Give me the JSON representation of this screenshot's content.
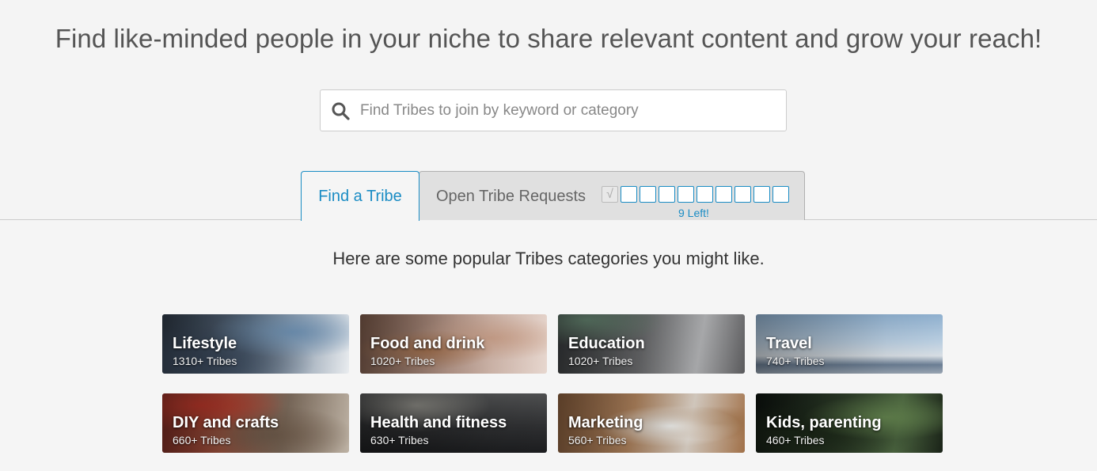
{
  "headline": "Find like-minded people in your niche to share relevant content and grow your reach!",
  "search": {
    "placeholder": "Find Tribes to join by keyword or category",
    "value": "",
    "icon": "search-icon"
  },
  "tabs": {
    "find_label": "Find a Tribe",
    "open_label": "Open Tribe Requests",
    "requests_used": 1,
    "requests_total": 10,
    "left_label": "9 Left!"
  },
  "subtitle": "Here are some popular Tribes categories you might like.",
  "categories": [
    {
      "title": "Lifestyle",
      "count": "1310+ Tribes"
    },
    {
      "title": "Food and drink",
      "count": "1020+ Tribes"
    },
    {
      "title": "Education",
      "count": "1020+ Tribes"
    },
    {
      "title": "Travel",
      "count": "740+ Tribes"
    },
    {
      "title": "DIY and crafts",
      "count": "660+ Tribes"
    },
    {
      "title": "Health and fitness",
      "count": "630+ Tribes"
    },
    {
      "title": "Marketing",
      "count": "560+ Tribes"
    },
    {
      "title": "Kids, parenting",
      "count": "460+ Tribes"
    }
  ],
  "colors": {
    "accent": "#1a8cc4",
    "background": "#f4f4f4"
  }
}
